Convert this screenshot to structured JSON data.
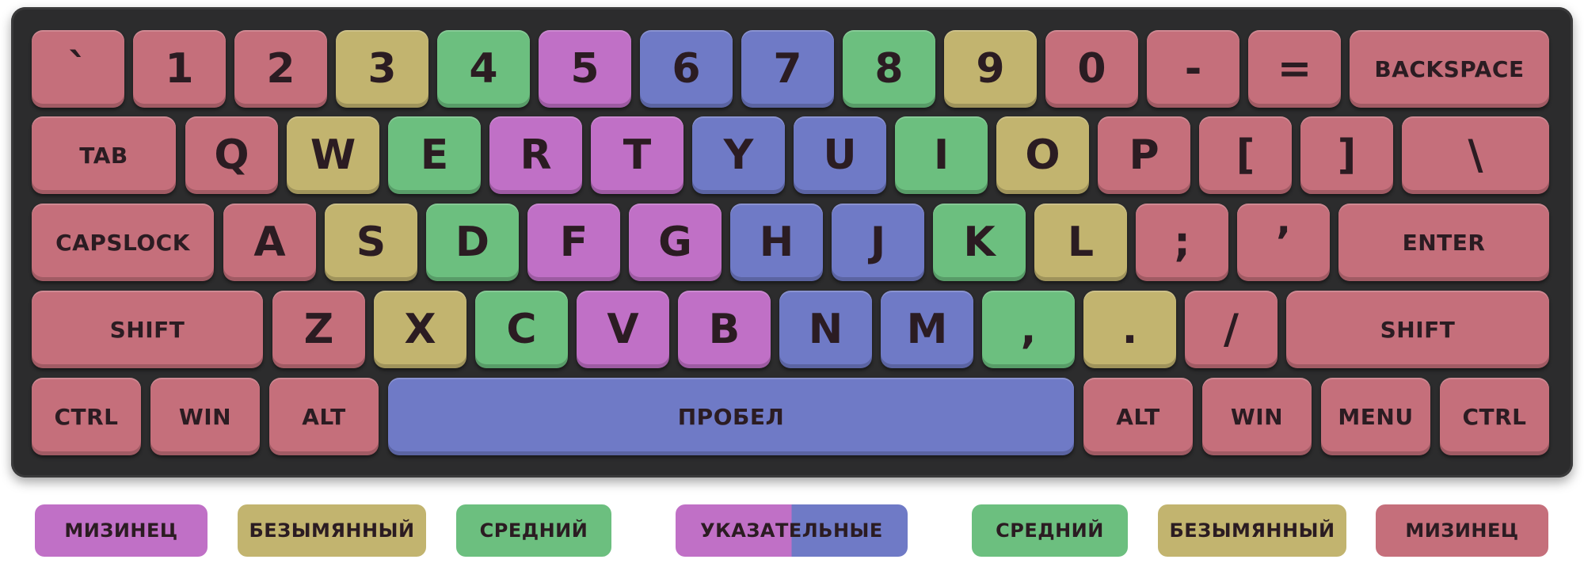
{
  "colors": {
    "pinky": "#c56f7b",
    "ring": "#c2b46f",
    "middle": "#6cbf7f",
    "index_left": "#c070c6",
    "index_right": "#6f7ac6",
    "case": "#2c2c2d"
  },
  "keyboard": {
    "rows": [
      [
        {
          "label": "`",
          "finger": "pinky"
        },
        {
          "label": "1",
          "finger": "pinky"
        },
        {
          "label": "2",
          "finger": "pinky"
        },
        {
          "label": "3",
          "finger": "ring"
        },
        {
          "label": "4",
          "finger": "middle"
        },
        {
          "label": "5",
          "finger": "index_left"
        },
        {
          "label": "6",
          "finger": "index_right"
        },
        {
          "label": "7",
          "finger": "index_right"
        },
        {
          "label": "8",
          "finger": "middle"
        },
        {
          "label": "9",
          "finger": "ring"
        },
        {
          "label": "0",
          "finger": "pinky"
        },
        {
          "label": "-",
          "finger": "pinky"
        },
        {
          "label": "=",
          "finger": "pinky"
        },
        {
          "label": "BACKSPACE",
          "finger": "pinky"
        }
      ],
      [
        {
          "label": "TAB",
          "finger": "pinky"
        },
        {
          "label": "Q",
          "finger": "pinky"
        },
        {
          "label": "W",
          "finger": "ring"
        },
        {
          "label": "E",
          "finger": "middle"
        },
        {
          "label": "R",
          "finger": "index_left"
        },
        {
          "label": "T",
          "finger": "index_left"
        },
        {
          "label": "Y",
          "finger": "index_right"
        },
        {
          "label": "U",
          "finger": "index_right"
        },
        {
          "label": "I",
          "finger": "middle"
        },
        {
          "label": "O",
          "finger": "ring"
        },
        {
          "label": "P",
          "finger": "pinky"
        },
        {
          "label": "[",
          "finger": "pinky"
        },
        {
          "label": "]",
          "finger": "pinky"
        },
        {
          "label": "\\",
          "finger": "pinky"
        }
      ],
      [
        {
          "label": "CAPSLOCK",
          "finger": "pinky"
        },
        {
          "label": "A",
          "finger": "pinky"
        },
        {
          "label": "S",
          "finger": "ring"
        },
        {
          "label": "D",
          "finger": "middle"
        },
        {
          "label": "F",
          "finger": "index_left"
        },
        {
          "label": "G",
          "finger": "index_left"
        },
        {
          "label": "H",
          "finger": "index_right"
        },
        {
          "label": "J",
          "finger": "index_right"
        },
        {
          "label": "K",
          "finger": "middle"
        },
        {
          "label": "L",
          "finger": "ring"
        },
        {
          "label": ";",
          "finger": "pinky"
        },
        {
          "label": "’",
          "finger": "pinky"
        },
        {
          "label": "ENTER",
          "finger": "pinky"
        }
      ],
      [
        {
          "label": "SHIFT",
          "finger": "pinky"
        },
        {
          "label": "Z",
          "finger": "pinky"
        },
        {
          "label": "X",
          "finger": "ring"
        },
        {
          "label": "C",
          "finger": "middle"
        },
        {
          "label": "V",
          "finger": "index_left"
        },
        {
          "label": "B",
          "finger": "index_left"
        },
        {
          "label": "N",
          "finger": "index_right"
        },
        {
          "label": "M",
          "finger": "index_right"
        },
        {
          "label": ",",
          "finger": "middle"
        },
        {
          "label": ".",
          "finger": "ring"
        },
        {
          "label": "/",
          "finger": "pinky"
        },
        {
          "label": "SHIFT",
          "finger": "pinky"
        }
      ],
      [
        {
          "label": "CTRL",
          "finger": "pinky"
        },
        {
          "label": "WIN",
          "finger": "pinky"
        },
        {
          "label": "ALT",
          "finger": "pinky"
        },
        {
          "label": "ПРОБЕЛ",
          "finger": "index_right"
        },
        {
          "label": "ALT",
          "finger": "pinky"
        },
        {
          "label": "WIN",
          "finger": "pinky"
        },
        {
          "label": "MENU",
          "finger": "pinky"
        },
        {
          "label": "CTRL",
          "finger": "pinky"
        }
      ]
    ]
  },
  "legend": [
    {
      "label": "МИЗИНЕЦ",
      "finger": "index_left"
    },
    {
      "label": "БЕЗЫМЯННЫЙ",
      "finger": "ring"
    },
    {
      "label": "СРЕДНИЙ",
      "finger": "middle"
    },
    {
      "label": "УКАЗАТЕЛЬНЫЕ",
      "finger": "split"
    },
    {
      "label": "СРЕДНИЙ",
      "finger": "middle"
    },
    {
      "label": "БЕЗЫМЯННЫЙ",
      "finger": "ring"
    },
    {
      "label": "МИЗИНЕЦ",
      "finger": "pinky"
    }
  ]
}
